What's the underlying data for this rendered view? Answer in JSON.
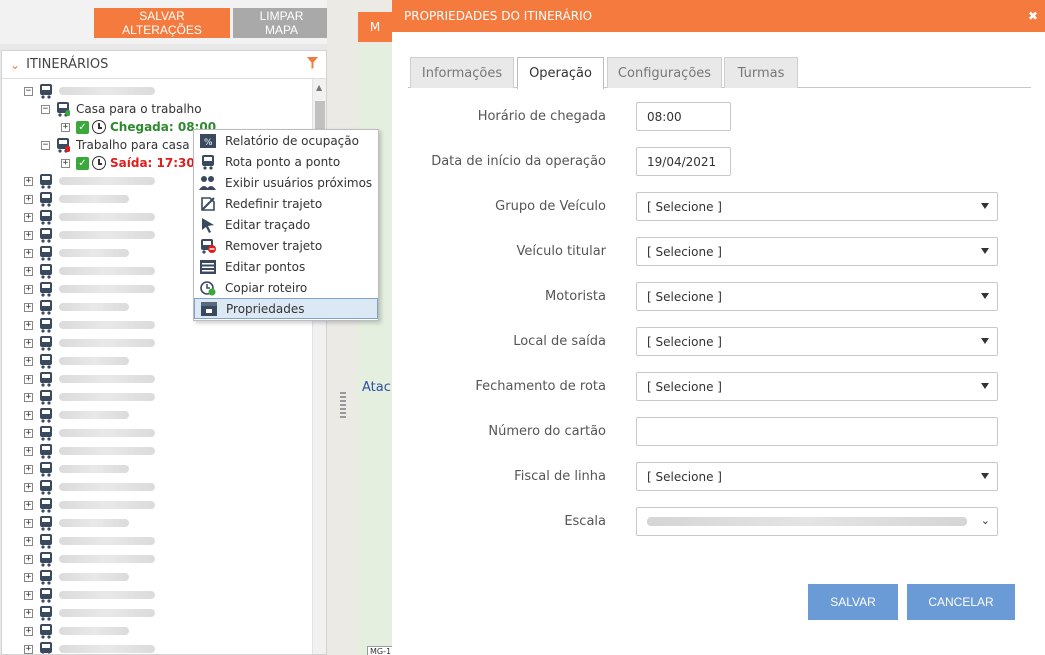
{
  "toolbar": {
    "save_label": "SALVAR ALTERAÇÕES",
    "clear_label": "LIMPAR MAPA"
  },
  "map": {
    "tab_label": "M",
    "place_text": "Atac",
    "road_label": "MG-1"
  },
  "left_panel": {
    "title": "ITINERÁRIOS",
    "tree": {
      "trip_out": {
        "name": "Casa para o trabalho",
        "time_label": "Chegada: 08:00"
      },
      "trip_back": {
        "name": "Trabalho para casa",
        "time_label": "Saída: 17:30"
      }
    }
  },
  "context_menu": {
    "items": [
      {
        "label": "Relatório de ocupação",
        "icon": "report-icon"
      },
      {
        "label": "Rota ponto a ponto",
        "icon": "bus-icon"
      },
      {
        "label": "Exibir usuários próximos",
        "icon": "users-icon"
      },
      {
        "label": "Redefinir trajeto",
        "icon": "route-reset-icon"
      },
      {
        "label": "Editar traçado",
        "icon": "cursor-icon"
      },
      {
        "label": "Remover trajeto",
        "icon": "bus-remove-icon"
      },
      {
        "label": "Editar pontos",
        "icon": "list-icon"
      },
      {
        "label": "Copiar roteiro",
        "icon": "copy-clock-icon"
      },
      {
        "label": "Propriedades",
        "icon": "properties-icon"
      }
    ]
  },
  "modal": {
    "title": "PROPRIEDADES DO ITINERÁRIO",
    "close_glyph": "✖",
    "tabs": [
      "Informações",
      "Operação",
      "Configurações",
      "Turmas"
    ],
    "active_tab": "Operação",
    "fields": {
      "arrival_time": {
        "label": "Horário de chegada",
        "value": "08:00"
      },
      "start_date": {
        "label": "Data de início da operação",
        "value": "19/04/2021"
      },
      "vehicle_group": {
        "label": "Grupo de Veículo",
        "value": "[ Selecione ]"
      },
      "main_vehicle": {
        "label": "Veículo titular",
        "value": "[ Selecione ]"
      },
      "driver": {
        "label": "Motorista",
        "value": "[ Selecione ]"
      },
      "departure_place": {
        "label": "Local de saída",
        "value": "[ Selecione ]"
      },
      "route_closing": {
        "label": "Fechamento de rota",
        "value": "[ Selecione ]"
      },
      "card_number": {
        "label": "Número do cartão",
        "value": ""
      },
      "line_inspector": {
        "label": "Fiscal de linha",
        "value": "[ Selecione ]"
      },
      "scale": {
        "label": "Escala"
      }
    },
    "save_label": "SALVAR",
    "cancel_label": "CANCELAR"
  },
  "colors": {
    "accent": "#f47a3d",
    "primary_button": "#6b9bd6",
    "arrival_green": "#2d8a2d",
    "departure_red": "#e11d1d"
  }
}
